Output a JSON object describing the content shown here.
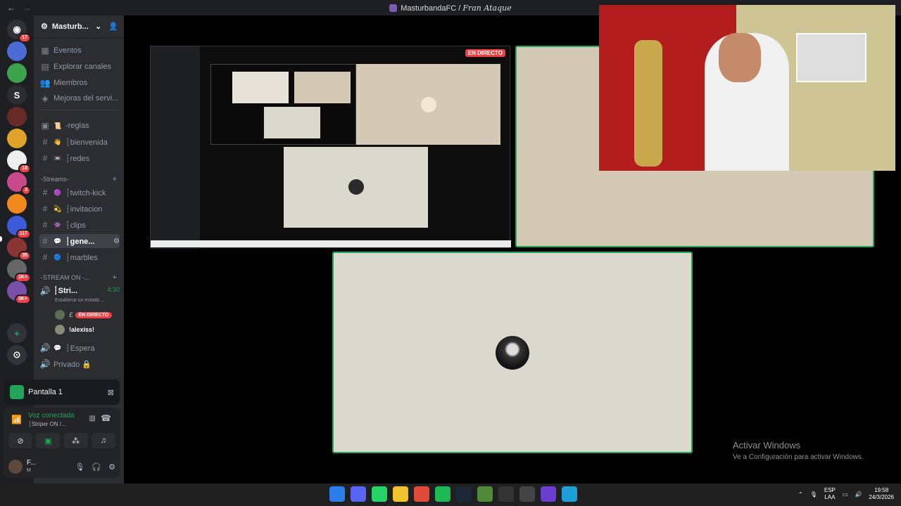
{
  "window": {
    "server": "MasturbandaFC",
    "separator": " / ",
    "channel": "Fran Ataque"
  },
  "guilds": [
    {
      "color": "#2f3136",
      "badge": "17",
      "glyph": "◉"
    },
    {
      "color": "#4a6cd4",
      "badge": "",
      "glyph": ""
    },
    {
      "color": "#3fa34d",
      "badge": "",
      "glyph": ""
    },
    {
      "color": "#2b2d31",
      "badge": "",
      "glyph": "S"
    },
    {
      "color": "#6b2a2a",
      "badge": "",
      "glyph": ""
    },
    {
      "color": "#e0a22a",
      "badge": "",
      "glyph": ""
    },
    {
      "color": "#eeeeee",
      "badge": "18",
      "glyph": ""
    },
    {
      "color": "#c94a8b",
      "badge": "3",
      "glyph": ""
    },
    {
      "color": "#f08a1e",
      "badge": "",
      "glyph": ""
    },
    {
      "color": "#3b5bdb",
      "badge": "117",
      "glyph": ""
    },
    {
      "color": "#8a3434",
      "badge": "35",
      "glyph": ""
    },
    {
      "color": "#666666",
      "badge": "1K+",
      "glyph": ""
    },
    {
      "color": "#7a4fa8",
      "badge": "3K+",
      "glyph": ""
    }
  ],
  "server_header": {
    "name": "Masturb..."
  },
  "menu": {
    "events": "Eventos",
    "browse": "Explorar canales",
    "members": "Miembros",
    "boosts": "Mejoras del servi..."
  },
  "channels_top": [
    {
      "emoji": "📜",
      "name": "-reglas"
    },
    {
      "emoji": "👋",
      "name": "┆bienvenida"
    },
    {
      "emoji": "📼",
      "name": "┆redes"
    }
  ],
  "category_streams": "-Streams-",
  "channels_streams": [
    {
      "emoji": "🟣",
      "name": "┆twitch-kick"
    },
    {
      "emoji": "💫",
      "name": "┆invitacion"
    },
    {
      "emoji": "👾",
      "name": "┆clips"
    },
    {
      "emoji": "💬",
      "name": "┆gene..."
    },
    {
      "emoji": "🔵",
      "name": "┆marbles"
    }
  ],
  "category_stream_on": "-STREAM ON -...",
  "voice_channel": {
    "name": "┆Stri...",
    "timer": "4:30",
    "status": "Establece un estado ..."
  },
  "voice_users": [
    {
      "name": "ℰ",
      "live": "EN DIRECTO"
    },
    {
      "name": "!alexiss!",
      "live": ""
    }
  ],
  "voice_others": [
    {
      "emoji": "💬",
      "name": "┆Espera"
    },
    {
      "emoji": "",
      "name": "Privado 🔒"
    }
  ],
  "pantalla": {
    "label": "Pantalla 1"
  },
  "voice_panel": {
    "title": "Voz conectada",
    "sub": "┆Striper ON /..."
  },
  "user": {
    "name": "F...",
    "status": "M"
  },
  "stage": {
    "live": "EN DIRECTO",
    "inner_title": "MasturbandaFC / Fran Ataque"
  },
  "activate": {
    "line1": "Activar Windows",
    "line2": "Ve a Configuración para activar Windows."
  },
  "taskbar": {
    "apps": [
      {
        "name": "windows",
        "color": "#2b7de9"
      },
      {
        "name": "discord",
        "color": "#5865f2"
      },
      {
        "name": "whatsapp",
        "color": "#25d366"
      },
      {
        "name": "explorer",
        "color": "#f2c12e"
      },
      {
        "name": "chrome",
        "color": "#e04a3a"
      },
      {
        "name": "spotify",
        "color": "#1db954"
      },
      {
        "name": "steam",
        "color": "#1b2838"
      },
      {
        "name": "minecraft",
        "color": "#4f8a3a"
      },
      {
        "name": "epic",
        "color": "#333333"
      },
      {
        "name": "obs",
        "color": "#444444"
      },
      {
        "name": "app",
        "color": "#6a3fd0"
      },
      {
        "name": "edge",
        "color": "#1e9fd6"
      }
    ],
    "lang1": "ESP",
    "lang2": "LAA",
    "time": "19:58",
    "date": "24/3/2026"
  }
}
